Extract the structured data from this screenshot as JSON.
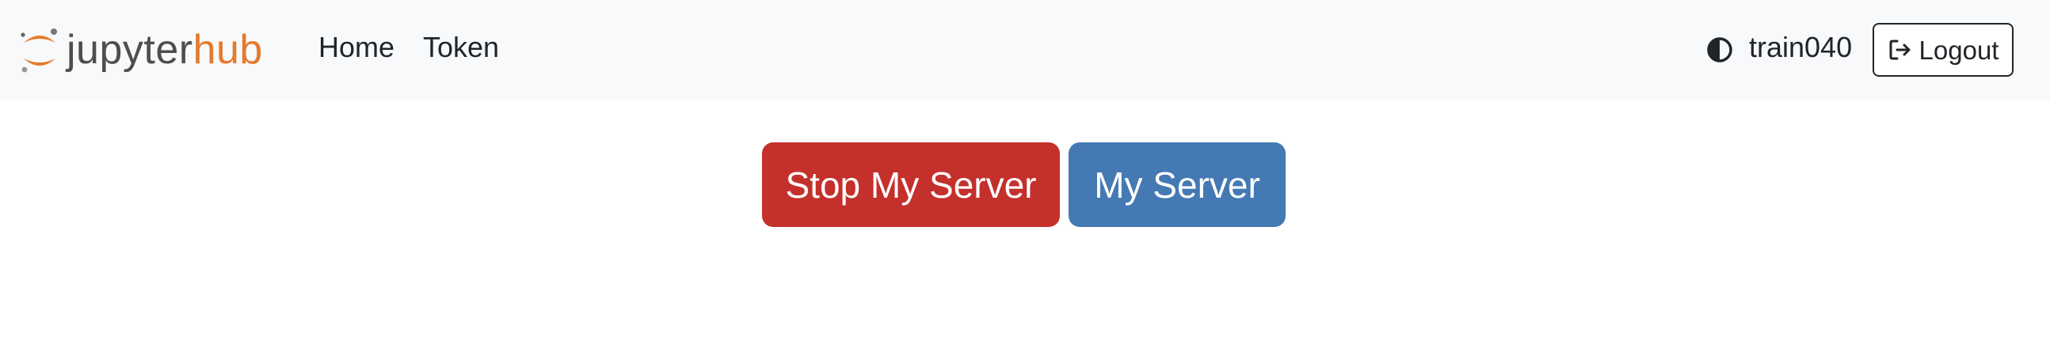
{
  "navbar": {
    "brand": {
      "logo_icon": "jupyter-logo-icon",
      "name_part1": "jupyter",
      "name_part2": "hub",
      "colors": {
        "jupyter": "#4e4e4e",
        "hub": "#e47a2d"
      }
    },
    "links": [
      {
        "label": "Home"
      },
      {
        "label": "Token"
      }
    ],
    "theme_toggle_icon": "half-circle-contrast-icon",
    "username": "train040",
    "logout": {
      "label": "Logout",
      "icon": "sign-out-icon"
    },
    "background": "#f8f9fa"
  },
  "main": {
    "stop_server_label": "Stop My Server",
    "my_server_label": "My Server",
    "colors": {
      "stop": "#c4302b",
      "my_server": "#4479b3"
    }
  }
}
